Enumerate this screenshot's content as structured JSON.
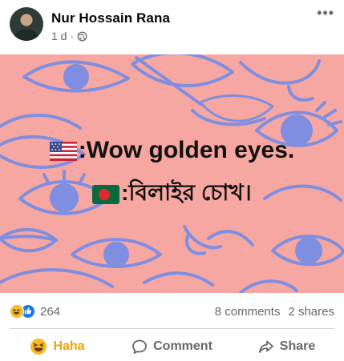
{
  "post": {
    "author": "Nur Hossain Rana",
    "time": "1 d",
    "separator": "·",
    "privacy_icon": "globe-icon",
    "more_icon": "more-options-icon",
    "more_glyph": "•••"
  },
  "banner": {
    "background": "#f7a7a1",
    "accent": "#7f8ee0",
    "line1_flag": "us-flag",
    "line1_text": ":Wow golden eyes.",
    "line2_flag": "bangladesh-flag",
    "line2_text": ":বিলাইর চোখ।"
  },
  "stats": {
    "reaction_icons": [
      "haha-reaction-icon",
      "like-reaction-icon"
    ],
    "reaction_count": "264",
    "comments": "8 comments",
    "shares": "2 shares"
  },
  "actions": {
    "haha_label": "Haha",
    "comment_label": "Comment",
    "share_label": "Share",
    "haha_color": "#e9a40e"
  }
}
